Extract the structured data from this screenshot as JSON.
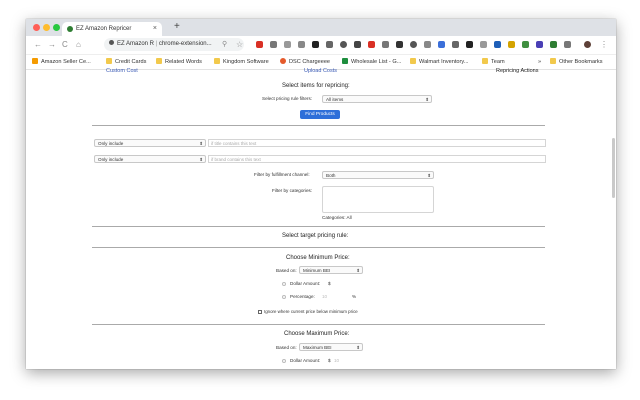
{
  "browser": {
    "tab_title": "EZ Amazon Repricer",
    "close_tab": "×",
    "new_tab": "+",
    "url_site": "EZ Amazon R",
    "url_path": "chrome-extension...",
    "back": "←",
    "forward": "→",
    "reload": "C",
    "home": "⌂",
    "menu": "⋮",
    "colors": {
      "red": "#ff5f57",
      "yellow": "#febc2e",
      "green": "#28c840"
    }
  },
  "bookmarks": [
    {
      "label": "Amazon Seller Ce...",
      "color": "#f59b00"
    },
    {
      "label": "Credit Cards",
      "color": "#f2c94c"
    },
    {
      "label": "Related Words",
      "color": "#f2c94c"
    },
    {
      "label": "Kingdom Software",
      "color": "#f2c94c"
    },
    {
      "label": "DSC Chargeeee",
      "color": "#e55a2b"
    },
    {
      "label": "Wholesale List - G...",
      "color": "#1e8e3e"
    },
    {
      "label": "Walmart Inventory...",
      "color": "#f2c94c"
    },
    {
      "label": "Team",
      "color": "#f2c94c"
    },
    {
      "label": "Other Bookmarks",
      "color": "#f2c94c"
    }
  ],
  "bookmarks_more": "»",
  "nav_links": {
    "custom_cost": "Custom Cost",
    "upload_costs": "Upload Costs",
    "repricing_actions": "Repricing Actions"
  },
  "select_items": {
    "heading": "Select items for repricing:",
    "filter_label": "Select pricing rule filters:",
    "filter_value": "All items",
    "find_button": "Find Products"
  },
  "filters": {
    "only_include_label": "Only include",
    "only_include_placeholder": "if title contains this text",
    "only_include_label2": "Only include",
    "only_include_placeholder2": "if brand contains this text",
    "fulfillment_label": "Filter by fulfillment channel:",
    "fulfillment_value": "Both",
    "categories_label": "Filter by categories:",
    "categories_text": "Categories: All"
  },
  "target_rule": {
    "heading": "Select target pricing rule:"
  },
  "minimum_price": {
    "heading": "Choose Minimum Price:",
    "based_on_label": "Based on:",
    "based_on_value": "Minimum BEI",
    "dollar_label": "Dollar Amount:",
    "dollar_symbol": "$",
    "percent_label": "Percentage:",
    "percent_value": "10",
    "percent_symbol": "%",
    "ignore_label": "Ignore where current price below minimum price"
  },
  "maximum_price": {
    "heading": "Choose Maximum Price:",
    "based_on_label": "Based on:",
    "based_on_value": "Maximum BEI",
    "dollar_label": "Dollar Amount:",
    "dollar_symbol": "$",
    "dollar_value": "10"
  },
  "caret": "⬍"
}
